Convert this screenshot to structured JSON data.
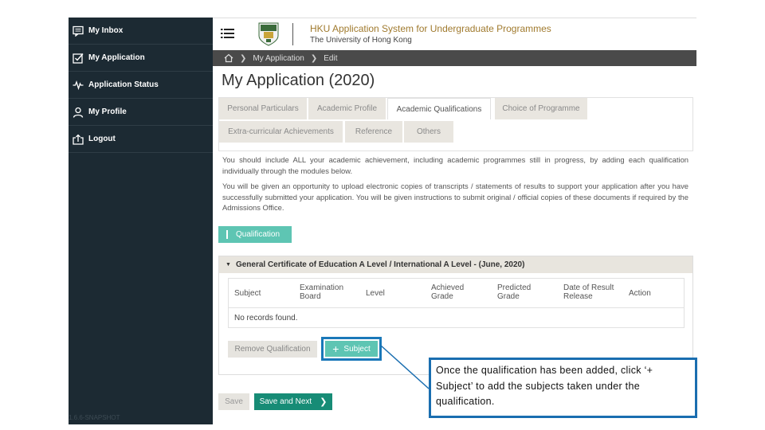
{
  "sidebar": {
    "items": [
      {
        "label": "My Inbox",
        "icon": "inbox-icon"
      },
      {
        "label": "My Application",
        "icon": "checkbox-icon"
      },
      {
        "label": "Application Status",
        "icon": "pulse-icon"
      },
      {
        "label": "My Profile",
        "icon": "user-icon"
      },
      {
        "label": "Logout",
        "icon": "logout-icon"
      }
    ],
    "version": "1.6.6-SNAPSHOT"
  },
  "header": {
    "title": "HKU Application System for Undergraduate Programmes",
    "subtitle": "The University of Hong Kong"
  },
  "breadcrumb": {
    "items": [
      "My Application",
      "Edit"
    ]
  },
  "page": {
    "title": "My Application (2020)"
  },
  "tabs": [
    {
      "label": "Personal Particulars",
      "active": false
    },
    {
      "label": "Academic Profile",
      "active": false
    },
    {
      "label": "Academic Qualifications",
      "active": true
    },
    {
      "label": "Choice of Programme",
      "active": false
    },
    {
      "label": "Extra-curricular Achievements",
      "active": false
    },
    {
      "label": "Reference",
      "active": false
    },
    {
      "label": "Others",
      "active": false
    }
  ],
  "instructions": {
    "p1": "You should include ALL your academic achievement, including academic programmes still in progress, by adding each qualification individually through the modules below.",
    "p2": "You will be given an opportunity to upload electronic copies of transcripts / statements of results to support your application after you have successfully submitted your application. You will be given instructions to submit original / official copies of these documents if required by the Admissions Office."
  },
  "qualification_button": "Qualification",
  "panel": {
    "title": "General Certificate of Education A Level / International A Level - (June, 2020)",
    "columns": [
      "Subject",
      "Examination Board",
      "Level",
      "Achieved Grade",
      "Predicted Grade",
      "Date of Result Release",
      "Action"
    ],
    "empty_message": "No records found.",
    "remove_button": "Remove Qualification",
    "subject_button": "Subject"
  },
  "footer": {
    "save": "Save",
    "save_next": "Save and Next"
  },
  "callout": {
    "text": "Once the qualification has been added, click ‘+ Subject’ to add the subjects taken under the qualification."
  },
  "colors": {
    "sidebar_bg": "#1c2a33",
    "accent_teal": "#5ec5b3",
    "primary_green": "#178c76",
    "callout_border": "#1a6eb0",
    "title_gold": "#a07a2e"
  }
}
